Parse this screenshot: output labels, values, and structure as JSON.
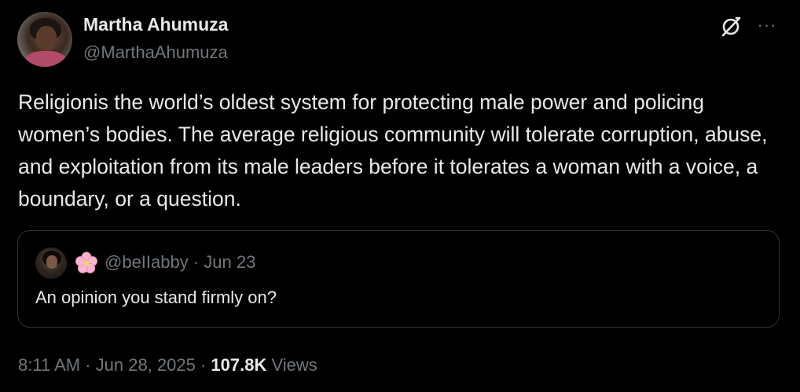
{
  "author": {
    "display_name": "Martha Ahumuza",
    "handle": "@MarthaAhumuza"
  },
  "header_icons": {
    "grok": "grok-icon",
    "more": "more-icon",
    "more_glyph": "···"
  },
  "tweet": {
    "text": "Religionis the world’s oldest system for protecting male power and policing women’s bodies. The average religious community will tolerate corruption, abuse, and exploitation from its male leaders before it tolerates a woman with a voice, a boundary, or a question."
  },
  "quote": {
    "handle_line": "@beIIabby · Jun 23",
    "text": "An opinion you stand firmly on?",
    "emoji_icon": "cherry-blossom-icon"
  },
  "meta": {
    "timestamp": "8:11 AM · Jun 28, 2025 · ",
    "views_count": "107.8K",
    "views_label": " Views"
  },
  "colors": {
    "background": "#000000",
    "primary_text": "#e7e9ea",
    "secondary_text": "#71767b",
    "border": "#2f3336"
  }
}
